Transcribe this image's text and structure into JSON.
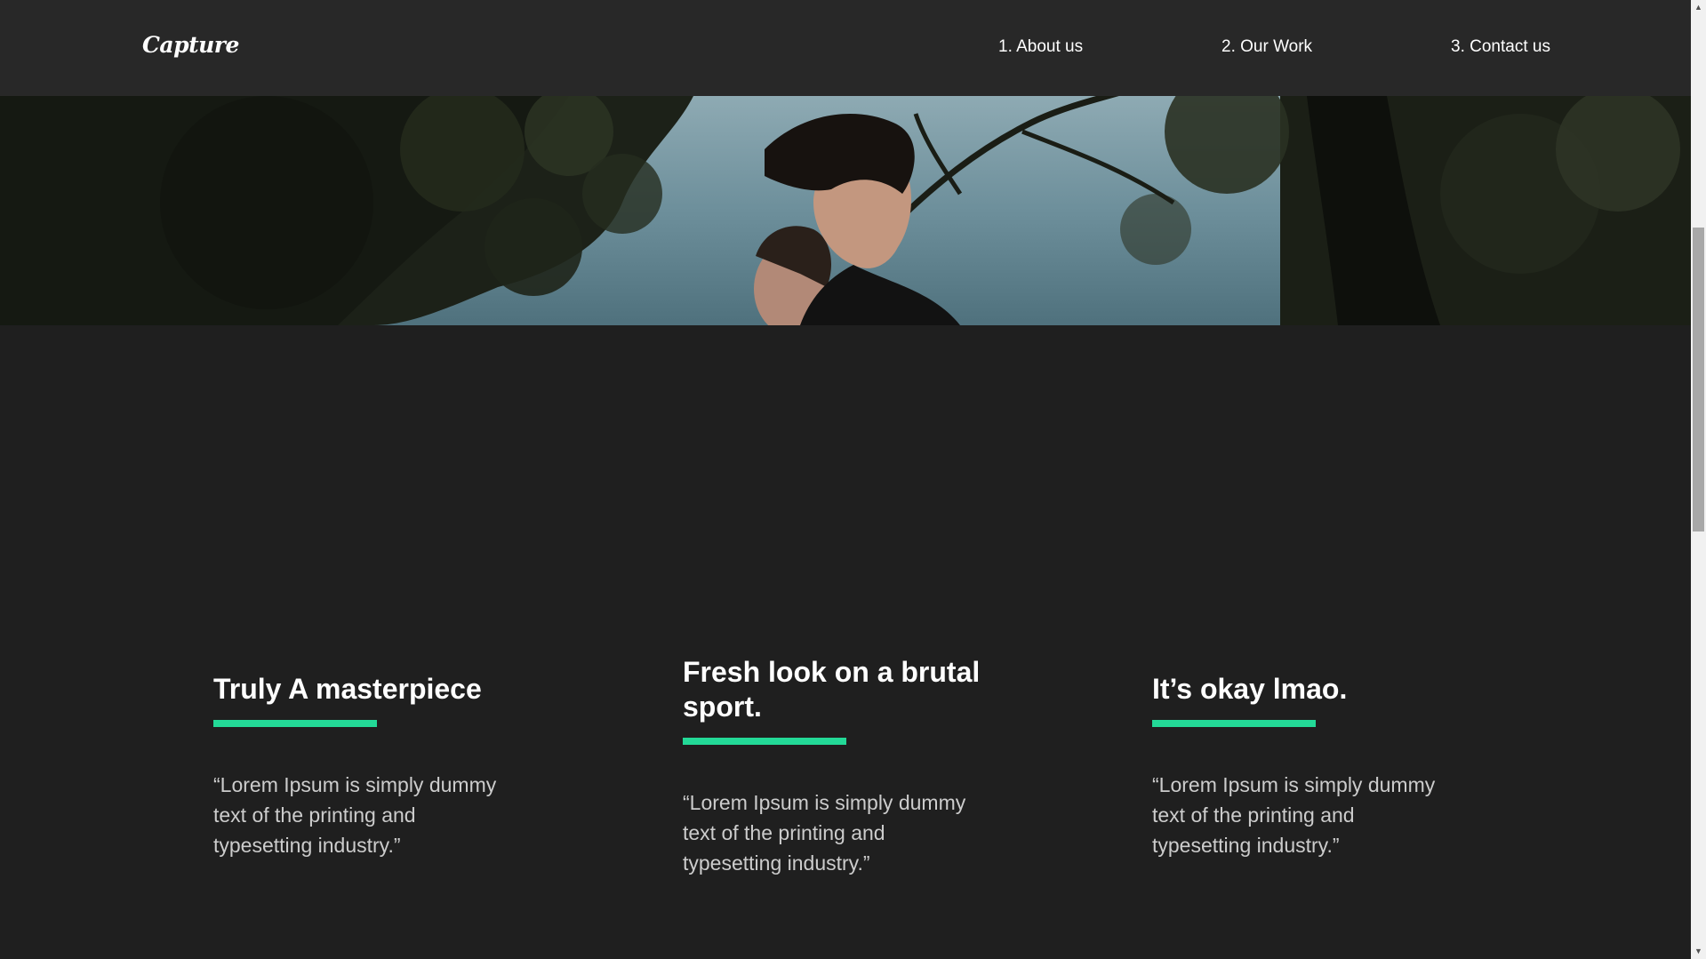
{
  "header": {
    "logo": "Capture",
    "nav": [
      {
        "label": "1. About us"
      },
      {
        "label": "2. Our Work"
      },
      {
        "label": "3. Contact us"
      }
    ]
  },
  "hero": {
    "description": "photo"
  },
  "cards": [
    {
      "title": "Truly A masterpiece",
      "quote": "“Lorem Ipsum is simply dummy text of the printing and typesetting industry.”"
    },
    {
      "title": "Fresh look on a brutal sport.",
      "quote": "“Lorem Ipsum is simply dummy text of the printing and typesetting industry.”"
    },
    {
      "title": "It’s okay lmao.",
      "quote": "“Lorem Ipsum is simply dummy text of the printing and typesetting industry.”"
    }
  ],
  "colors": {
    "background": "#1f1f1f",
    "header": "#282828",
    "accent": "#23d997",
    "text": "#ffffff"
  },
  "icons": {
    "scroll_up": "chevron-up-icon",
    "scroll_down": "chevron-down-icon"
  }
}
